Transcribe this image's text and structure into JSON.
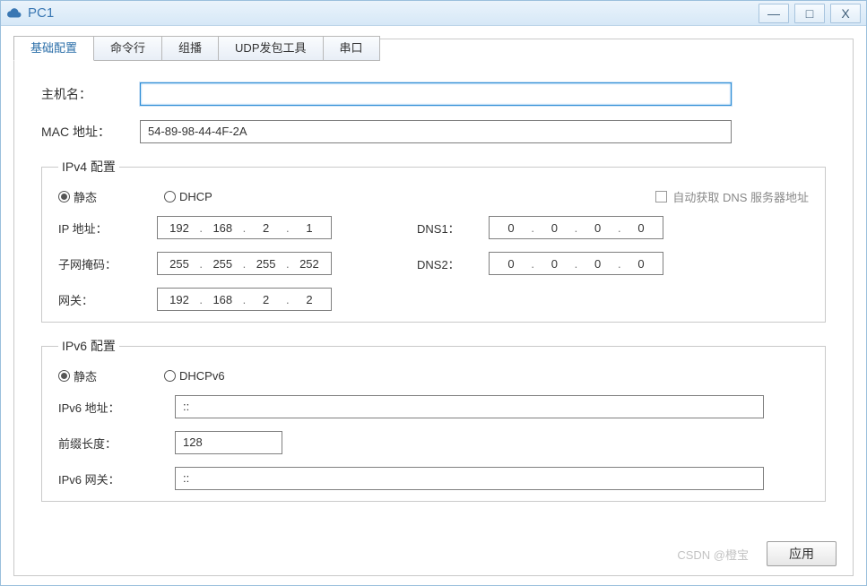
{
  "window": {
    "title": "PC1",
    "buttons": {
      "min": "—",
      "max": "□",
      "close": "X"
    }
  },
  "tabs": [
    "基础配置",
    "命令行",
    "组播",
    "UDP发包工具",
    "串口"
  ],
  "active_tab_index": 0,
  "hostname_label": "主机名：",
  "hostname_value": "",
  "mac_label": "MAC 地址：",
  "mac_value": "54-89-98-44-4F-2A",
  "ipv4": {
    "legend": "IPv4 配置",
    "radio_static": "静态",
    "radio_dhcp": "DHCP",
    "auto_dns_label": "自动获取 DNS 服务器地址",
    "labels": {
      "ip": "IP 地址：",
      "mask": "子网掩码：",
      "gw": "网关：",
      "dns1": "DNS1：",
      "dns2": "DNS2："
    },
    "ip": [
      "192",
      "168",
      "2",
      "1"
    ],
    "mask": [
      "255",
      "255",
      "255",
      "252"
    ],
    "gw": [
      "192",
      "168",
      "2",
      "2"
    ],
    "dns1": [
      "0",
      "0",
      "0",
      "0"
    ],
    "dns2": [
      "0",
      "0",
      "0",
      "0"
    ]
  },
  "ipv6": {
    "legend": "IPv6 配置",
    "radio_static": "静态",
    "radio_dhcp": "DHCPv6",
    "labels": {
      "addr": "IPv6 地址：",
      "prefix": "前缀长度：",
      "gw": "IPv6 网关："
    },
    "addr": "::",
    "prefix": "128",
    "gw": "::"
  },
  "apply_label": "应用",
  "watermark": "CSDN @橙宝"
}
